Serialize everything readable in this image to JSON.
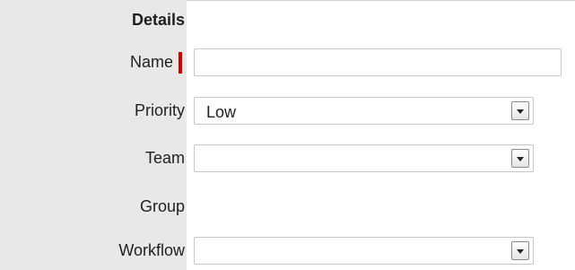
{
  "form": {
    "section_title": "Details",
    "fields": {
      "name": {
        "label": "Name",
        "value": "",
        "placeholder": ""
      },
      "priority": {
        "label": "Priority",
        "value": "Low"
      },
      "team": {
        "label": "Team",
        "value": ""
      },
      "group": {
        "label": "Group"
      },
      "workflow": {
        "label": "Workflow",
        "value": ""
      }
    },
    "colors": {
      "label_background": "#e8e8e8",
      "required_indicator": "#d40000",
      "border": "#c7c7c7"
    },
    "icons": {
      "select_arrow": "chevron-down-icon"
    }
  }
}
